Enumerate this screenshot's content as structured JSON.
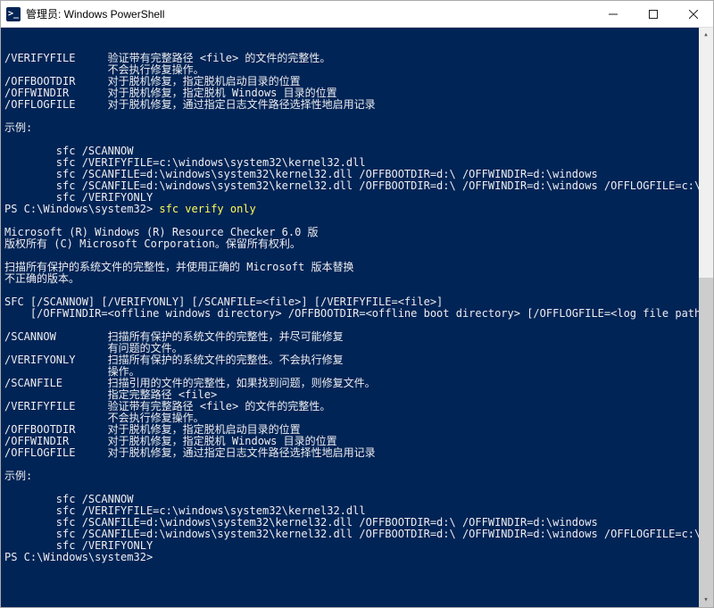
{
  "titlebar": {
    "icon_label": ">_",
    "title": "管理员: Windows PowerShell"
  },
  "terminal": {
    "lines": [
      {
        "t": "/VERIFYFILE     验证带有完整路径 <file> 的文件的完整性。"
      },
      {
        "t": "                不会执行修复操作。"
      },
      {
        "t": "/OFFBOOTDIR     对于脱机修复，指定脱机启动目录的位置"
      },
      {
        "t": "/OFFWINDIR      对于脱机修复，指定脱机 Windows 目录的位置"
      },
      {
        "t": "/OFFLOGFILE     对于脱机修复，通过指定日志文件路径选择性地启用记录"
      },
      {
        "t": ""
      },
      {
        "t": "示例:"
      },
      {
        "t": ""
      },
      {
        "t": "        sfc /SCANNOW"
      },
      {
        "t": "        sfc /VERIFYFILE=c:\\windows\\system32\\kernel32.dll"
      },
      {
        "t": "        sfc /SCANFILE=d:\\windows\\system32\\kernel32.dll /OFFBOOTDIR=d:\\ /OFFWINDIR=d:\\windows"
      },
      {
        "t": "        sfc /SCANFILE=d:\\windows\\system32\\kernel32.dll /OFFBOOTDIR=d:\\ /OFFWINDIR=d:\\windows /OFFLOGFILE=c:\\log.txt"
      },
      {
        "t": "        sfc /VERIFYONLY"
      },
      {
        "prompt": "PS C:\\Windows\\system32> ",
        "cmd": "sfc verify only"
      },
      {
        "t": ""
      },
      {
        "t": "Microsoft (R) Windows (R) Resource Checker 6.0 版"
      },
      {
        "t": "版权所有 (C) Microsoft Corporation。保留所有权利。"
      },
      {
        "t": ""
      },
      {
        "t": "扫描所有保护的系统文件的完整性，并使用正确的 Microsoft 版本替换"
      },
      {
        "t": "不正确的版本。"
      },
      {
        "t": ""
      },
      {
        "t": "SFC [/SCANNOW] [/VERIFYONLY] [/SCANFILE=<file>] [/VERIFYFILE=<file>]"
      },
      {
        "t": "    [/OFFWINDIR=<offline windows directory> /OFFBOOTDIR=<offline boot directory> [/OFFLOGFILE=<log file path>]]"
      },
      {
        "t": ""
      },
      {
        "t": "/SCANNOW        扫描所有保护的系统文件的完整性，并尽可能修复"
      },
      {
        "t": "                有问题的文件。"
      },
      {
        "t": "/VERIFYONLY     扫描所有保护的系统文件的完整性。不会执行修复"
      },
      {
        "t": "                操作。"
      },
      {
        "t": "/SCANFILE       扫描引用的文件的完整性，如果找到问题，则修复文件。"
      },
      {
        "t": "                指定完整路径 <file>"
      },
      {
        "t": "/VERIFYFILE     验证带有完整路径 <file> 的文件的完整性。"
      },
      {
        "t": "                不会执行修复操作。"
      },
      {
        "t": "/OFFBOOTDIR     对于脱机修复，指定脱机启动目录的位置"
      },
      {
        "t": "/OFFWINDIR      对于脱机修复，指定脱机 Windows 目录的位置"
      },
      {
        "t": "/OFFLOGFILE     对于脱机修复，通过指定日志文件路径选择性地启用记录"
      },
      {
        "t": ""
      },
      {
        "t": "示例:"
      },
      {
        "t": ""
      },
      {
        "t": "        sfc /SCANNOW"
      },
      {
        "t": "        sfc /VERIFYFILE=c:\\windows\\system32\\kernel32.dll"
      },
      {
        "t": "        sfc /SCANFILE=d:\\windows\\system32\\kernel32.dll /OFFBOOTDIR=d:\\ /OFFWINDIR=d:\\windows"
      },
      {
        "t": "        sfc /SCANFILE=d:\\windows\\system32\\kernel32.dll /OFFBOOTDIR=d:\\ /OFFWINDIR=d:\\windows /OFFLOGFILE=c:\\log.txt"
      },
      {
        "t": "        sfc /VERIFYONLY"
      },
      {
        "prompt": "PS C:\\Windows\\system32> ",
        "cmd": ""
      }
    ]
  }
}
